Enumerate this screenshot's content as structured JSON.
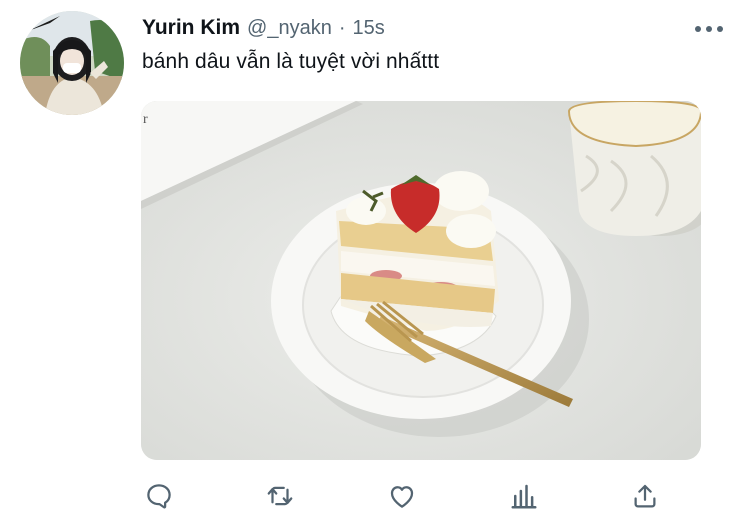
{
  "tweet": {
    "author_name": "Yurin Kim",
    "handle": "@_nyakn",
    "separator": "·",
    "timestamp": "15s",
    "text": "bánh dâu vẫn là tuyệt vời nhấttt"
  },
  "icons": {
    "more": "more-horizontal-icon",
    "reply": "reply-icon",
    "retweet": "retweet-icon",
    "like": "like-icon",
    "analytics": "analytics-icon",
    "share": "share-icon"
  },
  "colors": {
    "text_primary": "#0f1419",
    "text_secondary": "#536471",
    "icon": "#536471",
    "background": "#ffffff"
  }
}
